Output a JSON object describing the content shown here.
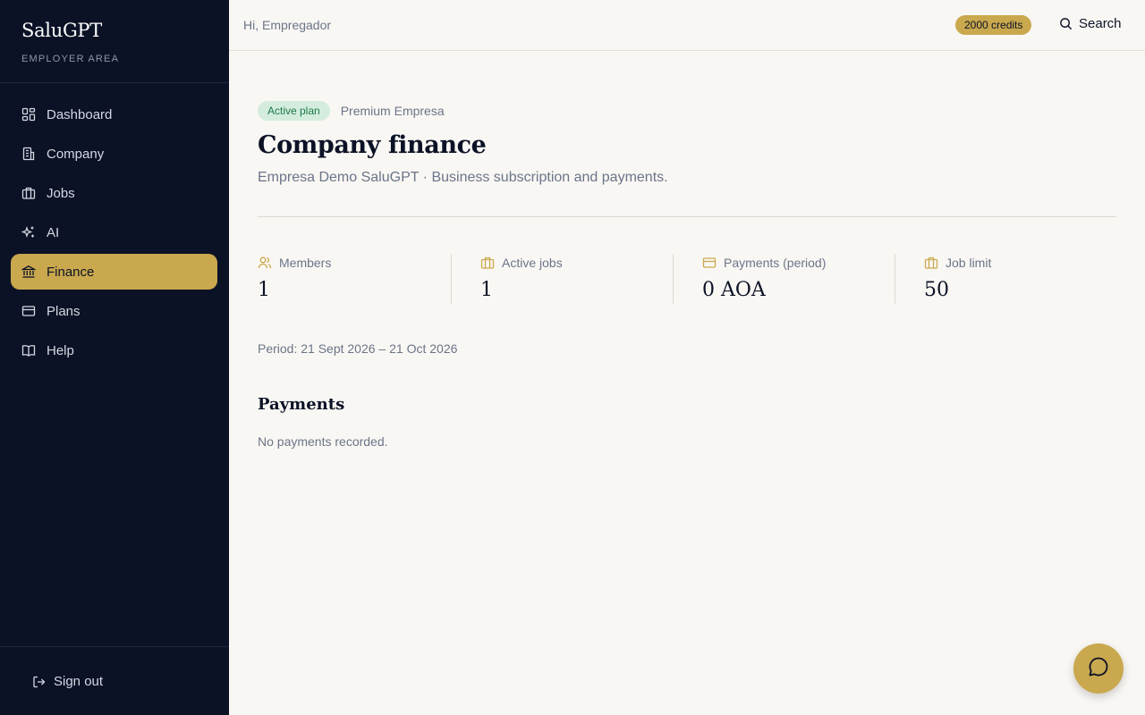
{
  "sidebar": {
    "brand": "SaluGPT",
    "subtitle": "EMPLOYER AREA",
    "items": [
      {
        "label": "Dashboard",
        "icon": "dashboard-icon"
      },
      {
        "label": "Company",
        "icon": "building-icon"
      },
      {
        "label": "Jobs",
        "icon": "briefcase-icon"
      },
      {
        "label": "AI",
        "icon": "sparkles-icon"
      },
      {
        "label": "Finance",
        "icon": "bank-icon",
        "active": true
      },
      {
        "label": "Plans",
        "icon": "credit-card-icon"
      },
      {
        "label": "Help",
        "icon": "book-icon"
      }
    ],
    "sign_out": "Sign out"
  },
  "topbar": {
    "greeting": "Hi, Empregador",
    "credits": "2000 credits",
    "search_label": "Search"
  },
  "main": {
    "plan_badge": "Active plan",
    "plan_name": "Premium Empresa",
    "title": "Company finance",
    "subtitle": "Empresa Demo SaluGPT · Business subscription and payments.",
    "stats": [
      {
        "label": "Members",
        "value": "1",
        "icon": "users-icon"
      },
      {
        "label": "Active jobs",
        "value": "1",
        "icon": "briefcase-icon"
      },
      {
        "label": "Payments (period)",
        "value": "0 AOA",
        "icon": "credit-card-icon"
      },
      {
        "label": "Job limit",
        "value": "50",
        "icon": "briefcase-icon"
      }
    ],
    "period": "Period: 21 Sept 2026 – 21 Oct 2026",
    "payments_title": "Payments",
    "payments_empty": "No payments recorded."
  },
  "colors": {
    "sidebar_bg": "#0c1226",
    "accent_gold": "#c9a84e",
    "page_bg": "#f9f7f3",
    "badge_green_bg": "#d3ecde",
    "badge_green_text": "#1e7a4a"
  }
}
